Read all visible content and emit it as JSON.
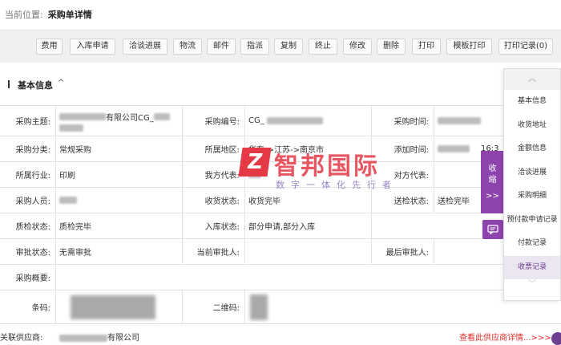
{
  "breadcrumb": {
    "prefix": "当前位置:",
    "current": "采购单详情"
  },
  "toolbar": {
    "buttons": [
      "费用",
      "入库申请",
      "洽谈进展",
      "物流",
      "邮件",
      "指派",
      "复制",
      "终止",
      "修改",
      "删除",
      "打印",
      "模板打印",
      "打印记录(0)"
    ]
  },
  "section": {
    "title": "基本信息",
    "caret": "^"
  },
  "fields": {
    "subject_label": "采购主题:",
    "subject_value": "有限公司CG_",
    "number_label": "采购编号:",
    "number_value": "CG_",
    "time_label": "采购时间:",
    "category_label": "采购分类:",
    "category_value": "常规采购",
    "region_label": "所属地区:",
    "region_value": "华东->江苏->南京市",
    "added_label": "添加时间:",
    "added_value": "16:3",
    "industry_label": "所属行业:",
    "industry_value": "印刷",
    "our_rep_label": "我方代表:",
    "their_rep_label": "对方代表:",
    "buyer_label": "采购人员:",
    "receive_status_label": "收货状态:",
    "receive_status_value": "收货完毕",
    "inspect_send_label": "送检状态:",
    "inspect_send_value": "送检完毕",
    "qc_status_label": "质检状态:",
    "qc_status_value": "质检完毕",
    "stock_status_label": "入库状态:",
    "stock_status_value": "部分申请,部分入库",
    "approve_status_label": "审批状态:",
    "approve_status_value": "无需审批",
    "current_approver_label": "当前审批人:",
    "last_approver_label": "最后审批人:",
    "summary_label": "采购概要:",
    "barcode_label": "条码:",
    "qrcode_label": "二维码:"
  },
  "supplier": {
    "label": "关联供应商:",
    "value": "有限公司",
    "link": "查看此供应商详情...>>>"
  },
  "side_panel": {
    "collapse_label": "收缩",
    "collapse_arrow": ">>",
    "items": [
      "基本信息",
      "收货地址",
      "金额信息",
      "洽谈进展",
      "采购明细",
      "预付款申请记录",
      "付款记录",
      "收票记录"
    ],
    "active_index": 7
  },
  "watermark": {
    "logo": "Z",
    "main": "智邦国际",
    "sub": "数字一体化先行者"
  },
  "colors": {
    "accent": "#8e44ad",
    "link": "#e02a2a",
    "watermark": "#e53946"
  }
}
